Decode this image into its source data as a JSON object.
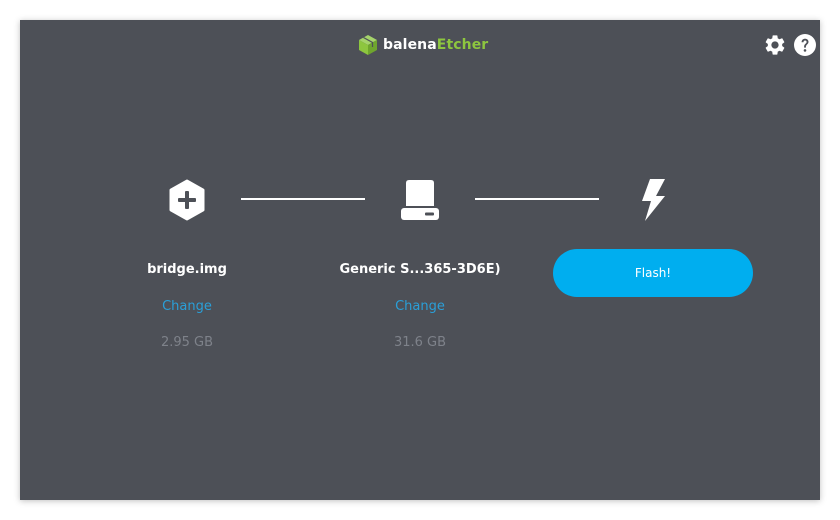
{
  "app": {
    "logo_balena": "balena",
    "logo_etcher": "Etcher",
    "icons": {
      "logo": "cube-logo-icon",
      "settings": "gear-icon",
      "help": "question-icon"
    },
    "colors": {
      "background": "#4d5057",
      "accent": "#00aeef",
      "link": "#2a9fd8",
      "brand_green": "#8dc63f",
      "muted": "#7e828a"
    }
  },
  "steps": {
    "image": {
      "icon": "plus-hexagon-icon",
      "title": "bridge.img",
      "change_label": "Change",
      "size": "2.95 GB"
    },
    "drive": {
      "icon": "drive-icon",
      "title": "Generic S...365-3D6E)",
      "change_label": "Change",
      "size": "31.6 GB"
    },
    "flash": {
      "icon": "lightning-icon",
      "button_label": "Flash!"
    }
  }
}
